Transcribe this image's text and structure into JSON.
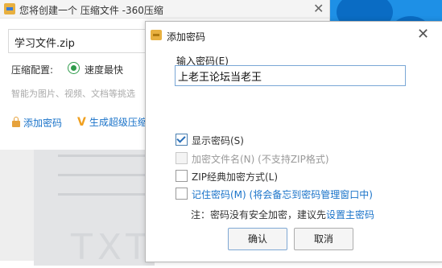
{
  "background_window": {
    "title": "您将创建一个 压缩文件 -360压缩",
    "close_glyph": "✕",
    "file_name": "学习文件.zip",
    "compress_config_label": "压缩配置:",
    "compress_mode": "速度最快",
    "hint_text": "智能为图片、视频、文档等挑选",
    "add_password_link": "添加密码",
    "generate_sfx_link": "生成超级压缩",
    "preview_text": "TXT"
  },
  "dialog": {
    "title": "添加密码",
    "close_glyph": "✕",
    "password_label": "输入密码(E)",
    "password_value": "上老王论坛当老王",
    "options": {
      "show_password": {
        "label": "显示密码(S)",
        "checked": true,
        "enabled": true
      },
      "encrypt_filenames": {
        "label": "加密文件名(N) (不支持ZIP格式)",
        "checked": false,
        "enabled": false
      },
      "zip_classic": {
        "label": "ZIP经典加密方式(L)",
        "checked": false,
        "enabled": true
      },
      "remember_password": {
        "label": "记住密码(M) (将会备忘到密码管理窗口中)",
        "checked": false,
        "enabled": true
      }
    },
    "note_prefix": "注：密码没有安全加密，建议先",
    "note_link": "设置主密码",
    "ok_button": "确认",
    "cancel_button": "取消"
  },
  "colors": {
    "accent_blue": "#1a73c9",
    "radio_green": "#2e9b4a",
    "bg_blue": "#1e90e6"
  }
}
